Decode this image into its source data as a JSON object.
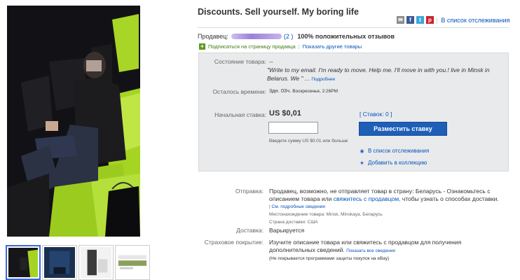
{
  "title": "Discounts. Sell yourself. My boring life",
  "header": {
    "watch_link": "В список отслеживания",
    "social_icons": [
      "mail-icon",
      "facebook-icon",
      "twitter-icon",
      "pinterest-icon"
    ]
  },
  "seller": {
    "label": "Продавец:",
    "feedback_count": "(2 )",
    "positive": "100% положительных отзывов",
    "subscribe": "Подписаться на страницу продавца",
    "other_items": "Показать другие товары"
  },
  "item": {
    "condition_label": "Состояние товара:",
    "condition_value": "--",
    "description": "\"Write to my email. I'm ready to move. Help me. I'll move in with you.! live in Minsk in Belarus. We \"",
    "more_link": "Подробнее",
    "time_label": "Осталось времени:",
    "time_value": "3дн. 03ч.",
    "time_detail": "Воскресенье, 2:26PM",
    "start_bid_label": "Начальная ставка:",
    "price": "US $0,01",
    "bids": "[ Ставок: 0 ]",
    "bid_input_value": "",
    "bid_hint": "Введите сумму US $0.01 или больше",
    "bid_button": "Разместить ставку",
    "watch": "В список отслеживания",
    "add_collection": "Добавить в коллекцию"
  },
  "shipping": {
    "label": "Отправка:",
    "text_before": "Продавец, возможно, не отправляет товар в страну: Беларусь - Ознакомьтесь с описанием товара или",
    "contact_link": "свяжитесь с продавцом,",
    "text_after": "чтобы узнать о способах доставки.",
    "details_prefix": "| ",
    "details_link": "См. подробные сведения",
    "location": "Местонахождение товара: Minsk, Minskaya, Беларусь",
    "ships_to": "Страна доставки: США"
  },
  "delivery": {
    "label": "Доставка:",
    "value": "Варьируется"
  },
  "insurance": {
    "label": "Страховое покрытие:",
    "value": "Изучите описание товара или свяжитесь с продавцом для получения дополнительных сведений.",
    "show_all": "Показать все сведения",
    "note": "(Не покрывается программами защиты покупок на eBay)"
  },
  "thumbnails": [
    "thumbnail-1",
    "thumbnail-2",
    "thumbnail-3",
    "thumbnail-4"
  ],
  "colors": {
    "link": "#0654ba",
    "button": "#1e5fb8",
    "box_bg": "#e9eaec",
    "seat_green": "#a6d422"
  }
}
